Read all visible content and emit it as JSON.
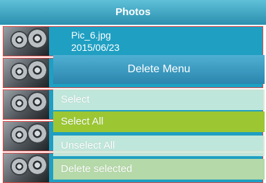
{
  "app": {
    "title": "Photos"
  },
  "photos": [
    {
      "name": "Pic_6.jpg",
      "date": "2015/06/23"
    },
    {
      "name": "",
      "date": ""
    },
    {
      "name": "",
      "date": ""
    },
    {
      "name": "",
      "date": ""
    },
    {
      "name": "",
      "date": ""
    }
  ],
  "menu": {
    "title": "Delete Menu",
    "items": [
      {
        "label": "Select"
      },
      {
        "label": "Select All"
      },
      {
        "label": "Unselect All"
      },
      {
        "label": "Delete selected"
      }
    ]
  },
  "colors": {
    "accent": "#2a8fae",
    "selected": "#9cc733",
    "rowBorder": "#e24a45"
  }
}
